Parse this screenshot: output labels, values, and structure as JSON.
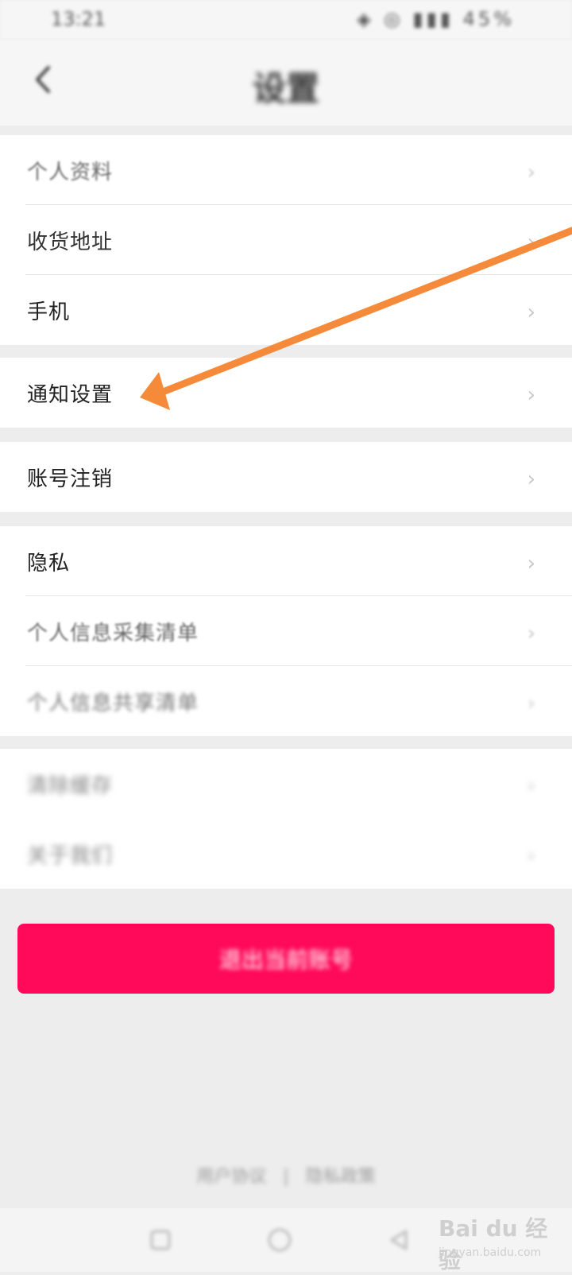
{
  "status_bar": {
    "time": "13:21",
    "icons_text": "◈ ◎ ▮▮▮ 45%"
  },
  "header": {
    "back_icon": "chevron-left-icon",
    "title": "设置"
  },
  "groups": [
    {
      "items": [
        {
          "label": "个人资料"
        },
        {
          "label": "收货地址"
        },
        {
          "label": "手机"
        }
      ]
    },
    {
      "items": [
        {
          "label": "通知设置"
        }
      ]
    },
    {
      "items": [
        {
          "label": "账号注销"
        }
      ]
    },
    {
      "items": [
        {
          "label": "隐私"
        },
        {
          "label": "个人信息采集清单"
        },
        {
          "label": "个人信息共享清单"
        }
      ]
    },
    {
      "items": [
        {
          "label": "清除缓存"
        },
        {
          "label": "关于我们"
        }
      ]
    }
  ],
  "chevron": "›",
  "logout_button": {
    "label": "退出当前账号"
  },
  "footer": {
    "link_left": "用户协议",
    "separator": "|",
    "link_right": "隐私政策"
  },
  "watermark": {
    "text": "Bai du 经验",
    "sub": "jingyan.baidu.com"
  },
  "annotation": {
    "arrow_color": "#f58a3a"
  },
  "colors": {
    "accent": "#ff0a5a",
    "background": "#ededed"
  }
}
